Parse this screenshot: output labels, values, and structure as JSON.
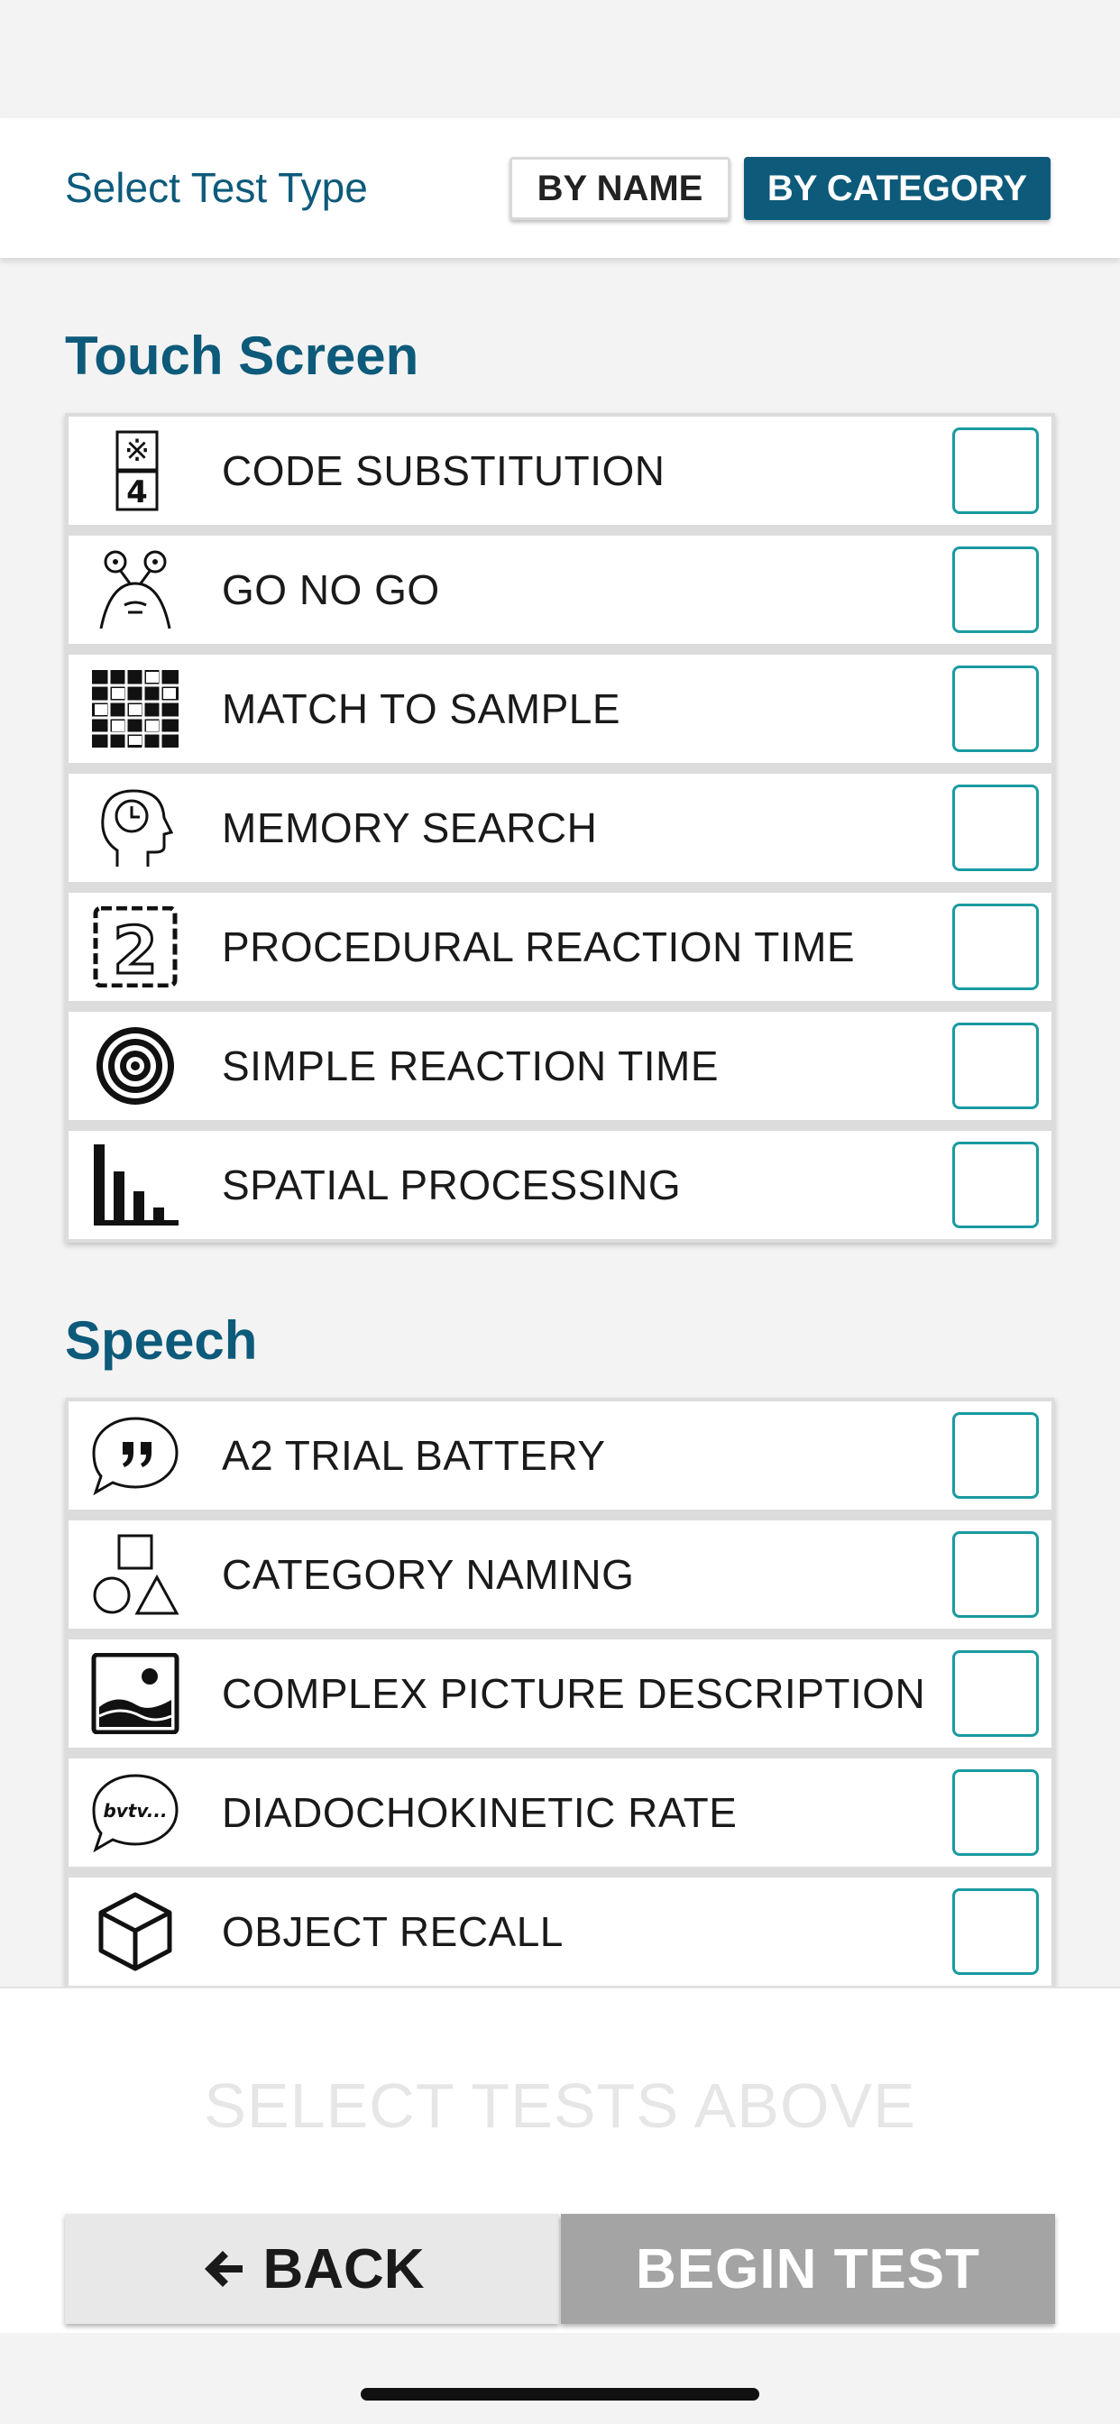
{
  "header": {
    "title": "Select Test Type",
    "by_name_label": "BY NAME",
    "by_category_label": "BY CATEGORY",
    "selected": "BY CATEGORY"
  },
  "sections": [
    {
      "title": "Touch Screen",
      "items": [
        {
          "label": "CODE SUBSTITUTION",
          "icon": "code-substitution-icon",
          "checked": false
        },
        {
          "label": "GO NO GO",
          "icon": "alien-icon",
          "checked": false
        },
        {
          "label": "MATCH TO SAMPLE",
          "icon": "grid-pattern-icon",
          "checked": false
        },
        {
          "label": "MEMORY SEARCH",
          "icon": "head-clock-icon",
          "checked": false
        },
        {
          "label": "PROCEDURAL REACTION TIME",
          "icon": "number-two-icon",
          "checked": false
        },
        {
          "label": "SIMPLE REACTION TIME",
          "icon": "target-icon",
          "checked": false
        },
        {
          "label": "SPATIAL PROCESSING",
          "icon": "bar-chart-icon",
          "checked": false
        }
      ]
    },
    {
      "title": "Speech",
      "items": [
        {
          "label": "A2 TRIAL BATTERY",
          "icon": "speech-quote-icon",
          "checked": false
        },
        {
          "label": "CATEGORY NAMING",
          "icon": "shapes-icon",
          "checked": false
        },
        {
          "label": "COMPLEX PICTURE DESCRIPTION",
          "icon": "picture-icon",
          "checked": false
        },
        {
          "label": "DIADOCHOKINETIC RATE",
          "icon": "speech-bubble-icon",
          "checked": false
        },
        {
          "label": "OBJECT RECALL",
          "icon": "cube-icon",
          "checked": false
        }
      ]
    }
  ],
  "icon_text": {
    "code_symbol": "※",
    "code_digit": "4",
    "proc_digit": "2",
    "ddk_text": "bvtv..."
  },
  "footer": {
    "message": "SELECT TESTS ABOVE",
    "back_label": "BACK",
    "begin_label": "BEGIN TEST"
  },
  "colors": {
    "accent": "#0d5a7a",
    "checkbox_border": "#1a9aa0",
    "disabled_button": "#a4a4a4"
  }
}
